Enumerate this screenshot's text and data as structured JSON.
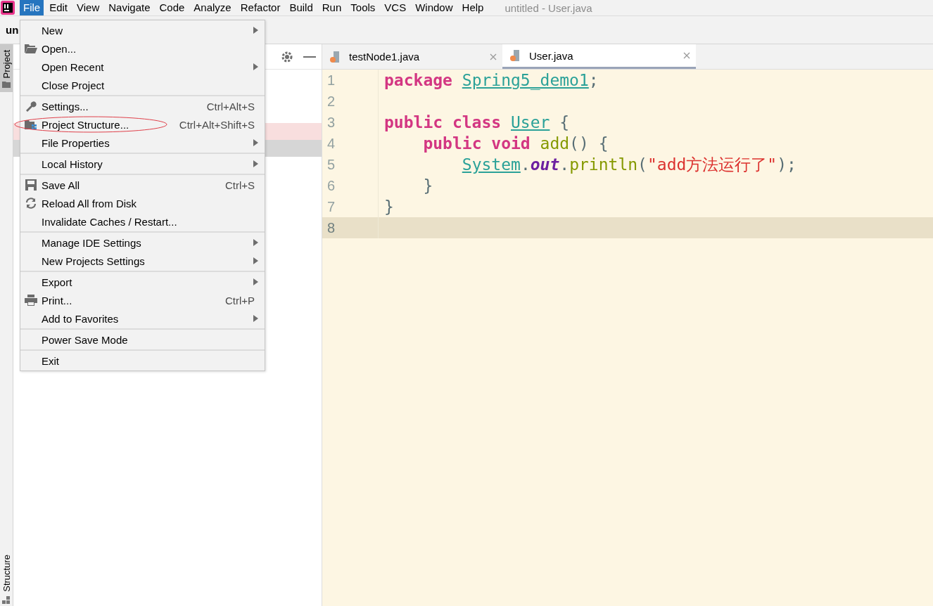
{
  "menubar": {
    "items": [
      {
        "label": "File",
        "selected": true
      },
      {
        "label": "Edit",
        "selected": false
      },
      {
        "label": "View",
        "selected": false
      },
      {
        "label": "Navigate",
        "selected": false
      },
      {
        "label": "Code",
        "selected": false
      },
      {
        "label": "Analyze",
        "selected": false
      },
      {
        "label": "Refactor",
        "selected": false
      },
      {
        "label": "Build",
        "selected": false
      },
      {
        "label": "Run",
        "selected": false
      },
      {
        "label": "Tools",
        "selected": false
      },
      {
        "label": "VCS",
        "selected": false
      },
      {
        "label": "Window",
        "selected": false
      },
      {
        "label": "Help",
        "selected": false
      }
    ],
    "title": "untitled - User.java"
  },
  "toolbar": {
    "project_name": "un"
  },
  "side_tabs": {
    "top": "Project",
    "bottom": "Structure"
  },
  "editor": {
    "tabs": [
      {
        "label": "testNode1.java",
        "selected": false
      },
      {
        "label": "User.java",
        "selected": true
      }
    ],
    "lines": [
      {
        "number": "1",
        "current": false,
        "tokens": [
          {
            "kind": "keyword",
            "text": "package "
          },
          {
            "kind": "link",
            "text": "Spring5_demo1"
          },
          {
            "kind": "plain",
            "text": ";"
          }
        ]
      },
      {
        "number": "2",
        "current": false
      },
      {
        "number": "3",
        "current": false,
        "tokens": [
          {
            "kind": "keyword",
            "text": "public class "
          },
          {
            "kind": "link",
            "text": "User"
          },
          {
            "kind": "plain",
            "text": " {"
          }
        ]
      },
      {
        "number": "4",
        "current": false,
        "tokens": [
          {
            "kind": "keyword",
            "text": "    public void "
          },
          {
            "kind": "method",
            "text": "add"
          },
          {
            "kind": "plain",
            "text": "() {"
          }
        ]
      },
      {
        "number": "5",
        "current": false,
        "tokens": [
          {
            "kind": "link",
            "text": "        System"
          },
          {
            "kind": "plain",
            "text": "."
          },
          {
            "kind": "field",
            "text": "out"
          },
          {
            "kind": "plain",
            "text": "."
          },
          {
            "kind": "method",
            "text": "println"
          },
          {
            "kind": "plain",
            "text": "("
          },
          {
            "kind": "string",
            "text": "\"add方法运行了\""
          },
          {
            "kind": "plain",
            "text": ");"
          }
        ]
      },
      {
        "number": "6",
        "current": false,
        "tokens": [
          {
            "kind": "plain",
            "text": "    }"
          }
        ]
      },
      {
        "number": "7",
        "current": false,
        "tokens": [
          {
            "kind": "plain",
            "text": "}"
          }
        ]
      },
      {
        "number": "8",
        "current": true
      }
    ]
  },
  "file_menu": {
    "groups": [
      [
        {
          "label": "New",
          "submenu": true,
          "kind": "plain"
        },
        {
          "label": "Open...",
          "submenu": false,
          "kind": "open"
        },
        {
          "label": "Open Recent",
          "submenu": true,
          "kind": "plain"
        },
        {
          "label": "Close Project",
          "submenu": false,
          "kind": "plain"
        }
      ],
      [
        {
          "label": "Settings...",
          "shortcut": "Ctrl+Alt+S",
          "submenu": false,
          "kind": "settings"
        },
        {
          "label": "Project Structure...",
          "shortcut": "Ctrl+Alt+Shift+S",
          "submenu": false,
          "kind": "structure",
          "circled": true
        },
        {
          "label": "File Properties",
          "submenu": true,
          "kind": "plain"
        }
      ],
      [
        {
          "label": "Local History",
          "submenu": true,
          "kind": "plain"
        }
      ],
      [
        {
          "label": "Save All",
          "shortcut": "Ctrl+S",
          "submenu": false,
          "kind": "save"
        },
        {
          "label": "Reload All from Disk",
          "submenu": false,
          "kind": "reload"
        },
        {
          "label": "Invalidate Caches / Restart...",
          "submenu": false,
          "kind": "plain"
        }
      ],
      [
        {
          "label": "Manage IDE Settings",
          "submenu": true,
          "kind": "plain"
        },
        {
          "label": "New Projects Settings",
          "submenu": true,
          "kind": "plain"
        }
      ],
      [
        {
          "label": "Export",
          "submenu": true,
          "kind": "plain"
        },
        {
          "label": "Print...",
          "shortcut": "Ctrl+P",
          "submenu": false,
          "kind": "print"
        },
        {
          "label": "Add to Favorites",
          "submenu": true,
          "kind": "plain"
        }
      ],
      [
        {
          "label": "Power Save Mode",
          "submenu": false,
          "kind": "plain"
        }
      ],
      [
        {
          "label": "Exit",
          "submenu": false,
          "kind": "plain"
        }
      ]
    ]
  }
}
